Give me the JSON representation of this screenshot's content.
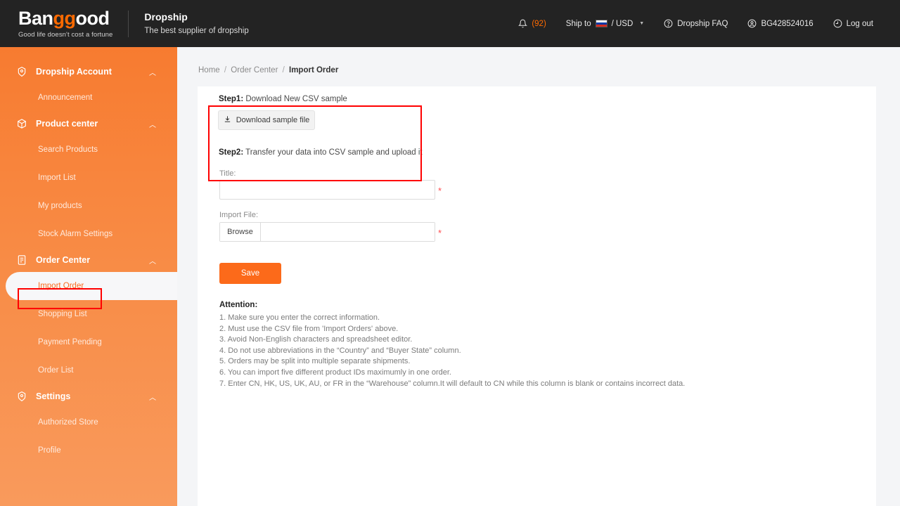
{
  "header": {
    "logo_text": "Banggood",
    "logo_highlight": "gg",
    "logo_tagline": "Good life doesn't cost a fortune",
    "dropship_title": "Dropship",
    "dropship_subtitle": "The best supplier of dropship",
    "notifications_count": "(92)",
    "ship_to_label": "Ship to",
    "currency": "/ USD",
    "faq_label": "Dropship FAQ",
    "account_id": "BG428524016",
    "logout_label": "Log out",
    "accent_color": "#ff6a00",
    "background_color": "#232323"
  },
  "sidebar": {
    "accent_color": "#f77b30",
    "groups": [
      {
        "label": "Dropship Account",
        "icon": "account-badge-icon",
        "items": [
          {
            "label": "Announcement",
            "active": false
          }
        ]
      },
      {
        "label": "Product center",
        "icon": "box-icon",
        "items": [
          {
            "label": "Search Products",
            "active": false
          },
          {
            "label": "Import List",
            "active": false
          },
          {
            "label": "My products",
            "active": false
          },
          {
            "label": "Stock Alarm Settings",
            "active": false
          }
        ]
      },
      {
        "label": "Order Center",
        "icon": "document-list-icon",
        "items": [
          {
            "label": "Import Order",
            "active": true
          },
          {
            "label": "Shopping List",
            "active": false
          },
          {
            "label": "Payment Pending",
            "active": false
          },
          {
            "label": "Order List",
            "active": false
          }
        ]
      },
      {
        "label": "Settings",
        "icon": "gear-target-icon",
        "items": [
          {
            "label": "Authorized Store",
            "active": false
          },
          {
            "label": "Profile",
            "active": false
          }
        ]
      }
    ]
  },
  "breadcrumb": {
    "home": "Home",
    "section": "Order Center",
    "current": "Import Order",
    "separator": "/"
  },
  "main": {
    "step1_prefix": "Step1:",
    "step1_text": " Download New CSV sample",
    "download_button": "Download sample file",
    "step2_prefix": "Step2:",
    "step2_text": " Transfer your data into CSV sample and upload it",
    "title_label": "Title:",
    "title_value": "",
    "title_required": "*",
    "import_file_label": "Import File:",
    "browse_label": "Browse",
    "import_file_value": "",
    "import_file_required": "*",
    "save_label": "Save",
    "attention_title": "Attention:",
    "attention_items": [
      "1. Make sure you enter the correct information.",
      "2. Must use the CSV file from 'Import Orders' above.",
      "3. Avoid Non-English characters and spreadsheet editor.",
      "4. Do not use abbreviations in the “Country” and “Buyer State” column.",
      "5. Orders may be split into multiple separate shipments.",
      "6. You can import five different product IDs maximumly in one order.",
      "7. Enter CN, HK, US, UK, AU, or FR in the “Warehouse” column.It will default to CN while this column is blank or contains incorrect data."
    ]
  },
  "annotations": {
    "highlight_color": "#ff0000"
  }
}
